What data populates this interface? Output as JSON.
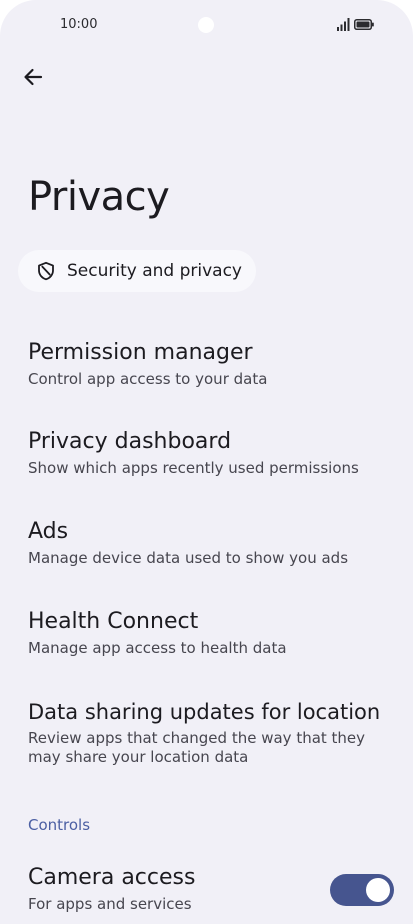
{
  "status_bar": {
    "time": "10:00"
  },
  "page": {
    "title": "Privacy"
  },
  "chip": {
    "label": "Security and privacy"
  },
  "items": [
    {
      "title": "Permission manager",
      "subtitle": "Control app access to your data"
    },
    {
      "title": "Privacy dashboard",
      "subtitle": "Show which apps recently used permissions"
    },
    {
      "title": "Ads",
      "subtitle": "Manage device data used to show you ads"
    },
    {
      "title": "Health Connect",
      "subtitle": "Manage app access to health data"
    },
    {
      "title": "Data sharing updates for location",
      "subtitle": "Review apps that changed the way that they may share your location data"
    }
  ],
  "controls": {
    "section_label": "Controls",
    "camera": {
      "title": "Camera access",
      "subtitle": "For apps and services",
      "enabled": true
    }
  },
  "icons": {
    "back": "arrow-left-icon",
    "shield": "shield-icon",
    "signal": "signal-icon",
    "battery": "battery-icon"
  },
  "colors": {
    "background": "#f1f0f7",
    "accent": "#46558f",
    "section_label": "#4b5fa3"
  }
}
